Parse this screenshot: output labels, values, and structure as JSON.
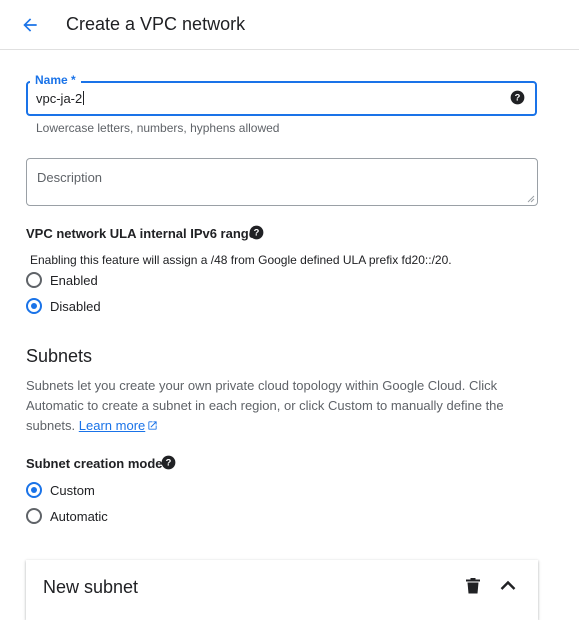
{
  "header": {
    "back_icon": "arrow-back-icon",
    "title": "Create a VPC network"
  },
  "form": {
    "name": {
      "label": "Name *",
      "value": "vpc-ja-2",
      "hint": "Lowercase letters, numbers, hyphens allowed",
      "help_icon": "help-icon"
    },
    "description": {
      "placeholder": "Description"
    },
    "ipv6": {
      "title": "VPC network ULA internal IPv6 range",
      "help_icon": "help-icon",
      "description": "Enabling this feature will assign a /48 from Google defined ULA prefix fd20::/20.",
      "options": [
        "Enabled",
        "Disabled"
      ],
      "selected": "Disabled"
    }
  },
  "subnets": {
    "title": "Subnets",
    "description": "Subnets let you create your own private cloud topology within Google Cloud. Click Automatic to create a subnet in each region, or click Custom to manually define the subnets.",
    "learn_more": "Learn more",
    "mode": {
      "title": "Subnet creation mode",
      "help_icon": "help-icon",
      "options": [
        "Custom",
        "Automatic"
      ],
      "selected": "Custom"
    },
    "new_subnet": {
      "title": "New subnet",
      "delete_icon": "delete-icon",
      "collapse_icon": "chevron-up-icon"
    }
  },
  "colors": {
    "accent": "#1a73e8",
    "text": "#202124",
    "secondary_text": "#5f6368"
  }
}
